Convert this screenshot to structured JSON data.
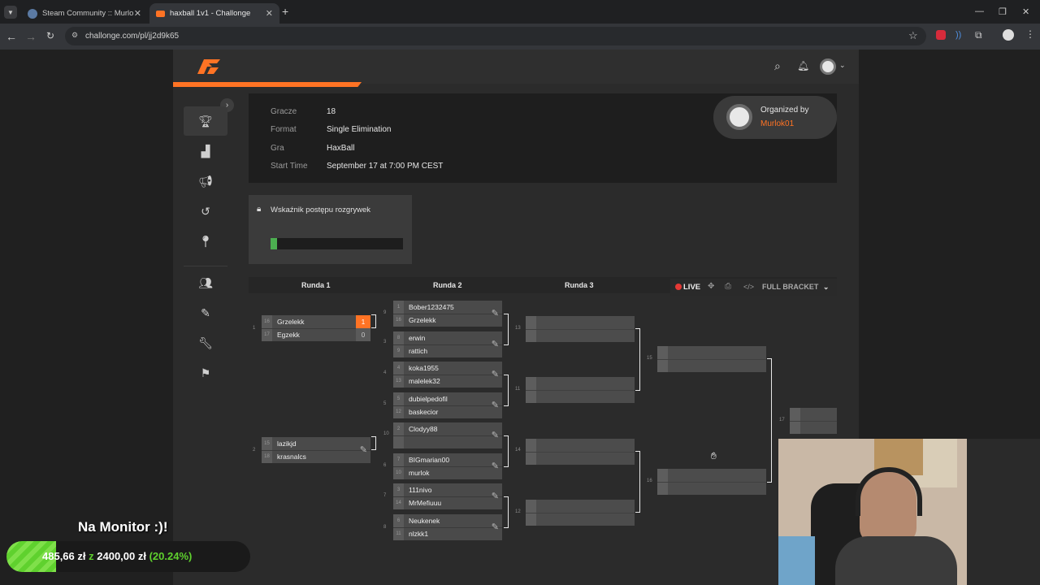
{
  "browser": {
    "tabs": [
      {
        "title": "Steam Community :: Murlok :: I",
        "active": false
      },
      {
        "title": "haxball 1v1 - Challonge",
        "active": true
      }
    ],
    "url": "challonge.com/pl/jj2d9k65"
  },
  "info": {
    "rows": [
      {
        "label": "Gracze",
        "value": "18"
      },
      {
        "label": "Format",
        "value": "Single Elimination"
      },
      {
        "label": "Gra",
        "value": "HaxBall"
      },
      {
        "label": "Start Time",
        "value": "September 17 at 7:00 PM CEST"
      }
    ],
    "organized_by_label": "Organized by",
    "organizer": "Murlok01"
  },
  "progress": {
    "title": "Wskaźnik postępu rozgrywek",
    "fraction": 0.05
  },
  "bracket": {
    "rounds": [
      "Runda 1",
      "Runda 2",
      "Runda 3"
    ],
    "live_label": "LIVE",
    "full_bracket_label": "FULL BRACKET",
    "round1": [
      {
        "id": "1",
        "p1": "Grzelekk",
        "s1": "16",
        "sc1": "1",
        "p2": "Egzekk",
        "s2": "17",
        "sc2": "0"
      },
      {
        "id": "2",
        "p1": "lazikjd",
        "s1": "15",
        "p2": "krasnalcs",
        "s2": "18"
      }
    ],
    "round2": [
      {
        "id": "9",
        "p1": "Bober1232475",
        "s1": "1",
        "p2": "Grzelekk",
        "s2": "16"
      },
      {
        "id": "3",
        "p1": "erwin",
        "s1": "8",
        "p2": "rattich",
        "s2": "9"
      },
      {
        "id": "4",
        "p1": "koka1955",
        "s1": "4",
        "p2": "malelek32",
        "s2": "13"
      },
      {
        "id": "5",
        "p1": "dubielpedofil",
        "s1": "5",
        "p2": "baskecior",
        "s2": "12"
      },
      {
        "id": "10",
        "p1": "Clodyy88",
        "s1": "2",
        "p2": "",
        "s2": ""
      },
      {
        "id": "6",
        "p1": "BIGmarian00",
        "s1": "7",
        "p2": "murlok",
        "s2": "10"
      },
      {
        "id": "7",
        "p1": "111nivo",
        "s1": "3",
        "p2": "MrMefiuuu",
        "s2": "14"
      },
      {
        "id": "8",
        "p1": "Neukenek",
        "s1": "6",
        "p2": "nlzkk1",
        "s2": "11"
      }
    ],
    "round3_ids": [
      "13",
      "11",
      "14",
      "12"
    ],
    "round4_ids": [
      "15",
      "16"
    ],
    "final_id": "17"
  },
  "overlay": {
    "title": "Na Monitor :)!",
    "amount": "485,66 zł",
    "of": "z",
    "goal": "2400,00 zł",
    "percent": "(20.24%)"
  },
  "colors": {
    "accent": "#ff7324",
    "progress": "#4caf50",
    "live": "#e53935"
  }
}
